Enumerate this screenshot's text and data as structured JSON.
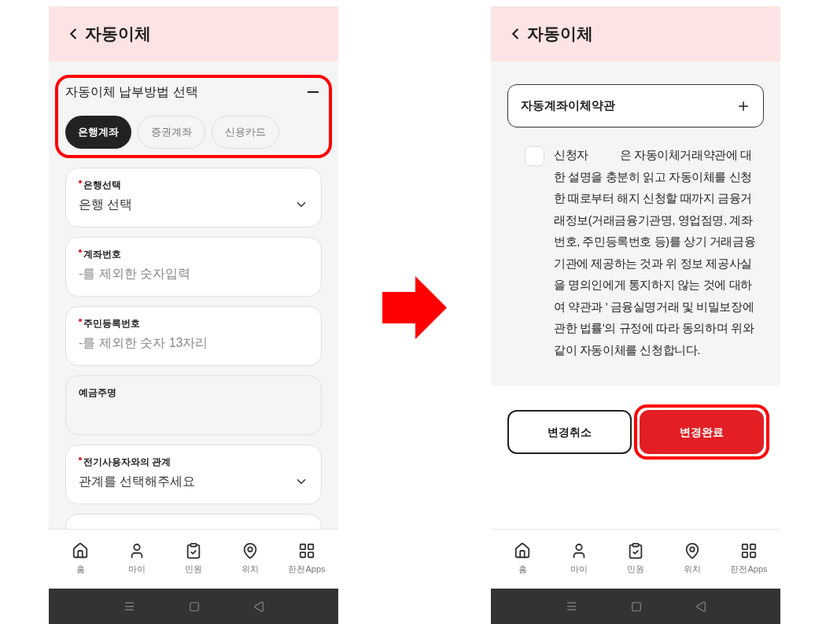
{
  "left_screen": {
    "header": {
      "title": "자동이체"
    },
    "method_section": {
      "title": "자동이체 납부방법 선택",
      "expanded": true,
      "highlighted": true,
      "options": [
        {
          "label": "은행계좌",
          "selected": true
        },
        {
          "label": "증권계좌",
          "selected": false
        },
        {
          "label": "신용카드",
          "selected": false
        }
      ]
    },
    "fields": [
      {
        "kind": "select",
        "label": "은행선택",
        "required": true,
        "value": "은행 선택"
      },
      {
        "kind": "input",
        "label": "계좌번호",
        "required": true,
        "placeholder": "-를 제외한 숫자입력"
      },
      {
        "kind": "input",
        "label": "주민등록번호",
        "required": true,
        "placeholder": "-를 제외한 숫자 13자리"
      },
      {
        "kind": "disabled",
        "label": "예금주명",
        "required": false
      },
      {
        "kind": "select",
        "label": "전기사용자와의 관계",
        "required": true,
        "value": "관계를 선택해주세요"
      },
      {
        "kind": "cut"
      }
    ],
    "bottom_nav": [
      {
        "label": "홈"
      },
      {
        "label": "마이"
      },
      {
        "label": "민원"
      },
      {
        "label": "위치"
      },
      {
        "label": "한전Apps"
      }
    ]
  },
  "right_screen": {
    "header": {
      "title": "자동이체"
    },
    "terms": {
      "title": "자동계좌이체약관",
      "expanded": false
    },
    "consent": {
      "checked": false,
      "text": "신청자           은 자동이체거래약관에 대한 설명을 충분히 읽고 자동이체를 신청한 때로부터 해지 신청할 때까지 금융거래정보(거래금융기관명, 영업점명, 계좌번호, 주민등록번호 등)를 상기 거래금융기관에 제공하는 것과 위 정보 제공사실을 명의인에게 통지하지 않는 것에 대하여 약관과 ' 금융실명거래 및 비밀보장에 관한 법률'의 규정에 따라 동의하며 위와 같이 자동이체를 신청합니다."
    },
    "buttons": [
      {
        "kind": "secondary",
        "label": "변경취소",
        "highlighted": false
      },
      {
        "kind": "primary",
        "label": "변경완료",
        "highlighted": true
      }
    ],
    "bottom_nav": [
      {
        "label": "홈"
      },
      {
        "label": "마이"
      },
      {
        "label": "민원"
      },
      {
        "label": "위치"
      },
      {
        "label": "한전Apps"
      }
    ]
  }
}
